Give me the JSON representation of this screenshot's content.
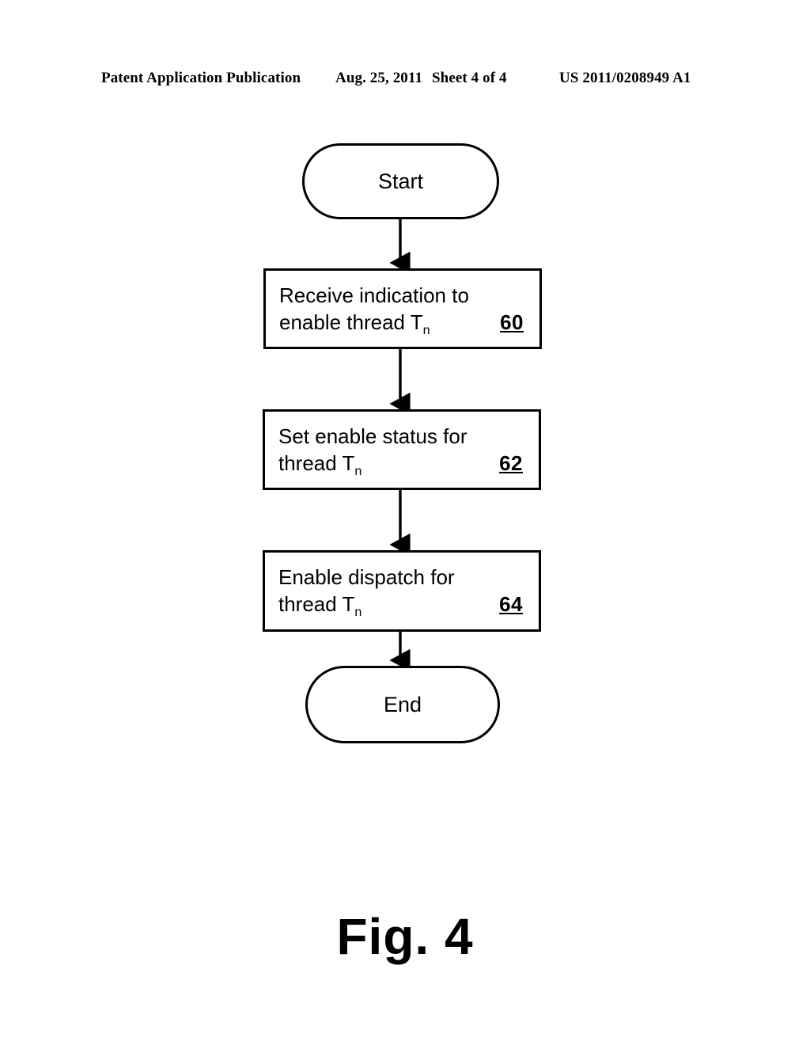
{
  "header": {
    "publication": "Patent Application Publication",
    "date": "Aug. 25, 2011",
    "sheet": "Sheet 4 of 4",
    "patent_number": "US 2011/0208949 A1"
  },
  "figure": {
    "caption": "Fig. 4",
    "type": "flowchart"
  },
  "flowchart": {
    "nodes": [
      {
        "id": "start",
        "shape": "terminator",
        "label": "Start",
        "ref": ""
      },
      {
        "id": "step60",
        "shape": "process",
        "line1": "Receive indication to",
        "line2_prefix": "enable thread T",
        "line2_sub": "n",
        "ref": "60"
      },
      {
        "id": "step62",
        "shape": "process",
        "line1": "Set enable status for",
        "line2_prefix": "thread T",
        "line2_sub": "n",
        "ref": "62"
      },
      {
        "id": "step64",
        "shape": "process",
        "line1": "Enable dispatch for",
        "line2_prefix": "thread T",
        "line2_sub": "n",
        "ref": "64"
      },
      {
        "id": "end",
        "shape": "terminator",
        "label": "End",
        "ref": ""
      }
    ],
    "edges": [
      {
        "from": "start",
        "to": "step60"
      },
      {
        "from": "step60",
        "to": "step62"
      },
      {
        "from": "step62",
        "to": "step64"
      },
      {
        "from": "step64",
        "to": "end"
      }
    ],
    "style": {
      "stroke": "#000000",
      "fill": "#ffffff",
      "line_width": 3
    }
  }
}
